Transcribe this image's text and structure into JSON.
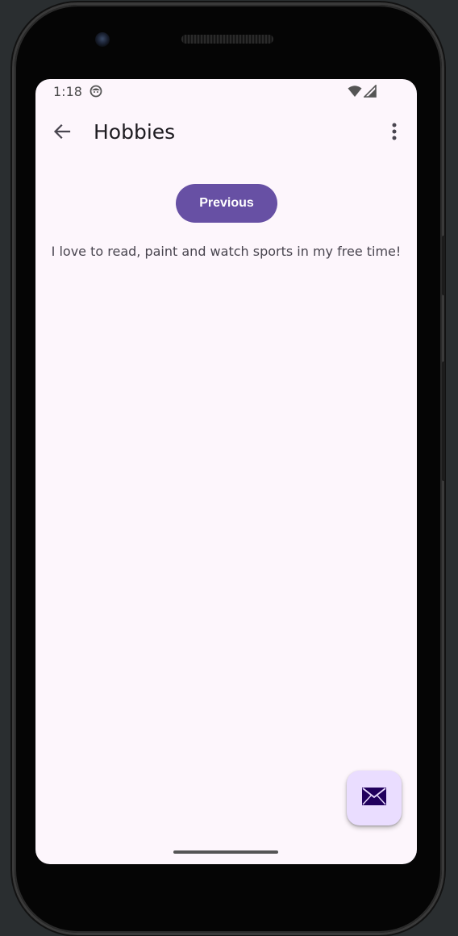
{
  "status_bar": {
    "time": "1:18",
    "icons": [
      "emoji-face-icon",
      "wifi-icon",
      "cellular-signal-icon"
    ]
  },
  "app_bar": {
    "title": "Hobbies",
    "back_icon": "arrow-left-icon",
    "overflow_icon": "more-vert-icon"
  },
  "content": {
    "previous_label": "Previous",
    "text": "I love to read, paint and watch sports in my free time!"
  },
  "fab": {
    "icon": "mail-icon"
  },
  "colors": {
    "primary": "#6750a4",
    "fab_container": "#eaddff",
    "surface": "#fdf6fc",
    "on_fab": "#21005d"
  }
}
